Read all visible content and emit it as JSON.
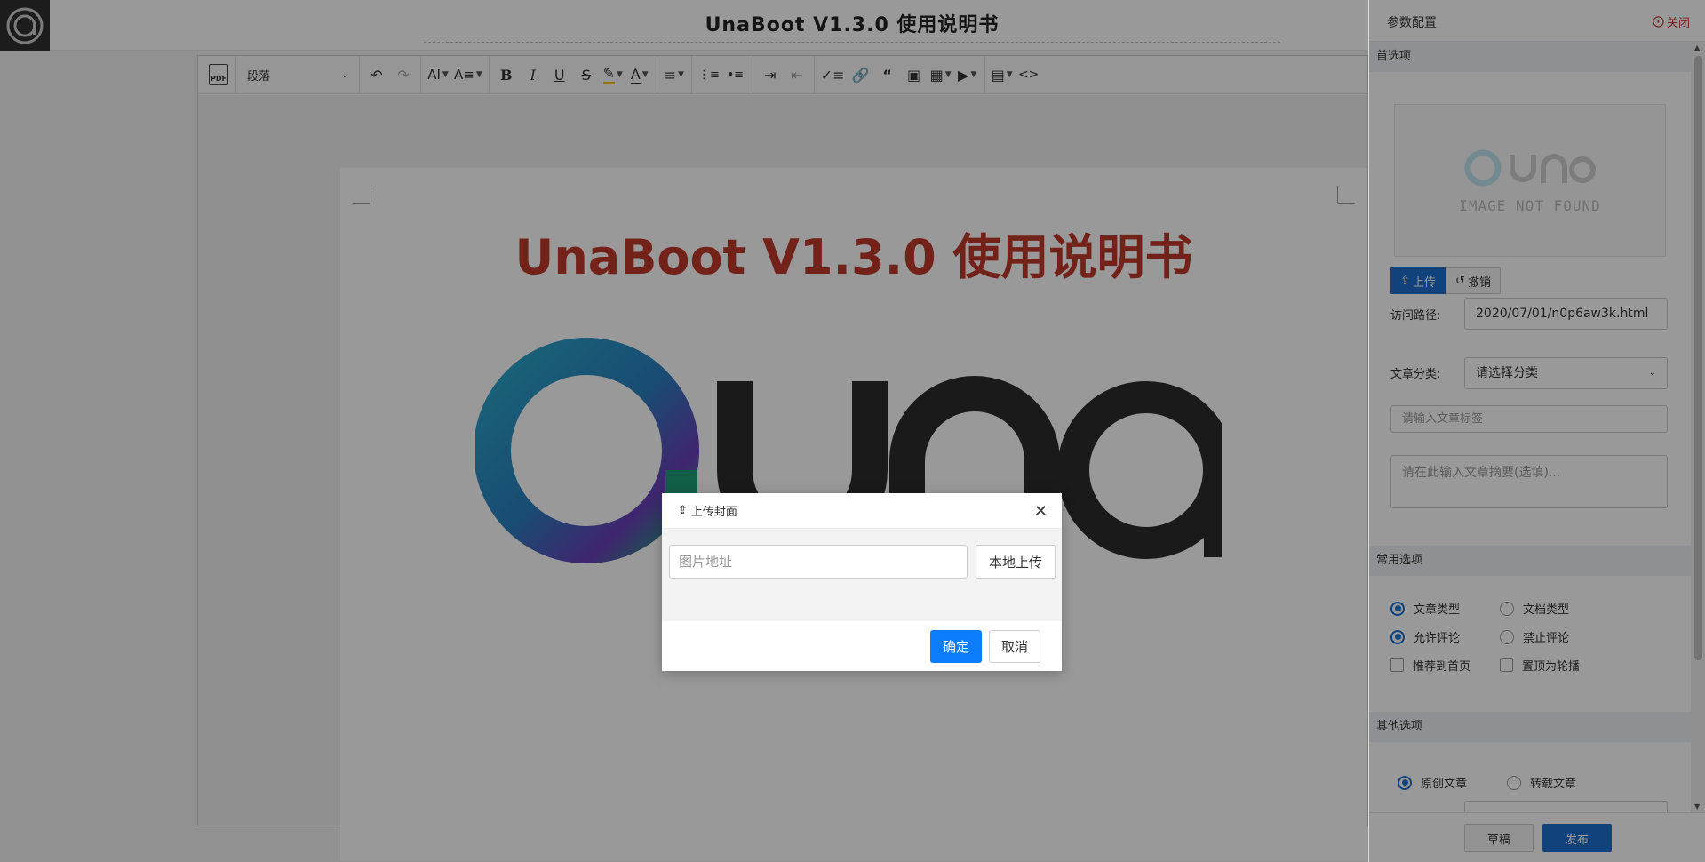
{
  "header": {
    "title": "UnaBoot V1.3.0 使用说明书"
  },
  "toolbar": {
    "block_format": "段落",
    "icons": [
      "pdf-icon",
      "undo-icon",
      "redo-icon",
      "font-size-icon",
      "line-height-icon",
      "bold-icon",
      "italic-icon",
      "underline-icon",
      "strikethrough-icon",
      "highlight-icon",
      "font-color-icon",
      "align-icon",
      "ordered-list-icon",
      "unordered-list-icon",
      "indent-icon",
      "outdent-icon",
      "checklist-icon",
      "link-icon",
      "quote-icon",
      "image-icon",
      "table-icon",
      "media-icon",
      "template-icon",
      "code-view-icon"
    ]
  },
  "document": {
    "heading": "UnaBoot V1.3.0 使用说明书",
    "heading_color": "#c0392b"
  },
  "sidepanel": {
    "title": "参数配置",
    "close_label": "关闭",
    "sections": {
      "preferences": "首选项",
      "common": "常用选项",
      "other": "其他选项"
    },
    "cover": {
      "placeholder_text": "IMAGE NOT FOUND"
    },
    "upload_label": "上传",
    "revoke_label": "撤销",
    "path_label": "访问路径:",
    "path_value": "2020/07/01/n0p6aw3k.html",
    "category_label": "文章分类:",
    "category_value": "请选择分类",
    "tags_placeholder": "请输入文章标签",
    "summary_placeholder": "请在此输入文章摘要(选填)...",
    "common_options": {
      "article_type": "文章类型",
      "doc_type": "文档类型",
      "allow_comments": "允许评论",
      "forbid_comments": "禁止评论",
      "recommend_home": "推荐到首页",
      "top_carousel": "置顶为轮播"
    },
    "other_options": {
      "original": "原创文章",
      "reprint": "转载文章"
    },
    "draft_label": "草稿",
    "publish_label": "发布",
    "accent": "#1e6fce"
  },
  "modal": {
    "title": "上传封面",
    "url_placeholder": "图片地址",
    "local_upload_label": "本地上传",
    "ok_label": "确定",
    "cancel_label": "取消",
    "ok_color": "#0b7dfa"
  }
}
